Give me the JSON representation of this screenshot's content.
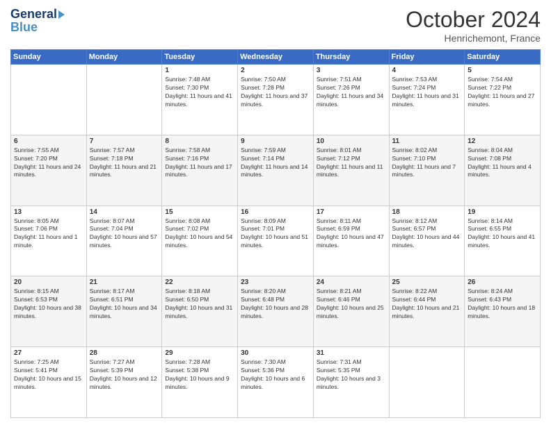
{
  "header": {
    "logo_general": "General",
    "logo_blue": "Blue",
    "month": "October 2024",
    "location": "Henrichemont, France"
  },
  "days_of_week": [
    "Sunday",
    "Monday",
    "Tuesday",
    "Wednesday",
    "Thursday",
    "Friday",
    "Saturday"
  ],
  "weeks": [
    [
      {
        "day": "",
        "sunrise": "",
        "sunset": "",
        "daylight": ""
      },
      {
        "day": "",
        "sunrise": "",
        "sunset": "",
        "daylight": ""
      },
      {
        "day": "1",
        "sunrise": "Sunrise: 7:48 AM",
        "sunset": "Sunset: 7:30 PM",
        "daylight": "Daylight: 11 hours and 41 minutes."
      },
      {
        "day": "2",
        "sunrise": "Sunrise: 7:50 AM",
        "sunset": "Sunset: 7:28 PM",
        "daylight": "Daylight: 11 hours and 37 minutes."
      },
      {
        "day": "3",
        "sunrise": "Sunrise: 7:51 AM",
        "sunset": "Sunset: 7:26 PM",
        "daylight": "Daylight: 11 hours and 34 minutes."
      },
      {
        "day": "4",
        "sunrise": "Sunrise: 7:53 AM",
        "sunset": "Sunset: 7:24 PM",
        "daylight": "Daylight: 11 hours and 31 minutes."
      },
      {
        "day": "5",
        "sunrise": "Sunrise: 7:54 AM",
        "sunset": "Sunset: 7:22 PM",
        "daylight": "Daylight: 11 hours and 27 minutes."
      }
    ],
    [
      {
        "day": "6",
        "sunrise": "Sunrise: 7:55 AM",
        "sunset": "Sunset: 7:20 PM",
        "daylight": "Daylight: 11 hours and 24 minutes."
      },
      {
        "day": "7",
        "sunrise": "Sunrise: 7:57 AM",
        "sunset": "Sunset: 7:18 PM",
        "daylight": "Daylight: 11 hours and 21 minutes."
      },
      {
        "day": "8",
        "sunrise": "Sunrise: 7:58 AM",
        "sunset": "Sunset: 7:16 PM",
        "daylight": "Daylight: 11 hours and 17 minutes."
      },
      {
        "day": "9",
        "sunrise": "Sunrise: 7:59 AM",
        "sunset": "Sunset: 7:14 PM",
        "daylight": "Daylight: 11 hours and 14 minutes."
      },
      {
        "day": "10",
        "sunrise": "Sunrise: 8:01 AM",
        "sunset": "Sunset: 7:12 PM",
        "daylight": "Daylight: 11 hours and 11 minutes."
      },
      {
        "day": "11",
        "sunrise": "Sunrise: 8:02 AM",
        "sunset": "Sunset: 7:10 PM",
        "daylight": "Daylight: 11 hours and 7 minutes."
      },
      {
        "day": "12",
        "sunrise": "Sunrise: 8:04 AM",
        "sunset": "Sunset: 7:08 PM",
        "daylight": "Daylight: 11 hours and 4 minutes."
      }
    ],
    [
      {
        "day": "13",
        "sunrise": "Sunrise: 8:05 AM",
        "sunset": "Sunset: 7:06 PM",
        "daylight": "Daylight: 11 hours and 1 minute."
      },
      {
        "day": "14",
        "sunrise": "Sunrise: 8:07 AM",
        "sunset": "Sunset: 7:04 PM",
        "daylight": "Daylight: 10 hours and 57 minutes."
      },
      {
        "day": "15",
        "sunrise": "Sunrise: 8:08 AM",
        "sunset": "Sunset: 7:02 PM",
        "daylight": "Daylight: 10 hours and 54 minutes."
      },
      {
        "day": "16",
        "sunrise": "Sunrise: 8:09 AM",
        "sunset": "Sunset: 7:01 PM",
        "daylight": "Daylight: 10 hours and 51 minutes."
      },
      {
        "day": "17",
        "sunrise": "Sunrise: 8:11 AM",
        "sunset": "Sunset: 6:59 PM",
        "daylight": "Daylight: 10 hours and 47 minutes."
      },
      {
        "day": "18",
        "sunrise": "Sunrise: 8:12 AM",
        "sunset": "Sunset: 6:57 PM",
        "daylight": "Daylight: 10 hours and 44 minutes."
      },
      {
        "day": "19",
        "sunrise": "Sunrise: 8:14 AM",
        "sunset": "Sunset: 6:55 PM",
        "daylight": "Daylight: 10 hours and 41 minutes."
      }
    ],
    [
      {
        "day": "20",
        "sunrise": "Sunrise: 8:15 AM",
        "sunset": "Sunset: 6:53 PM",
        "daylight": "Daylight: 10 hours and 38 minutes."
      },
      {
        "day": "21",
        "sunrise": "Sunrise: 8:17 AM",
        "sunset": "Sunset: 6:51 PM",
        "daylight": "Daylight: 10 hours and 34 minutes."
      },
      {
        "day": "22",
        "sunrise": "Sunrise: 8:18 AM",
        "sunset": "Sunset: 6:50 PM",
        "daylight": "Daylight: 10 hours and 31 minutes."
      },
      {
        "day": "23",
        "sunrise": "Sunrise: 8:20 AM",
        "sunset": "Sunset: 6:48 PM",
        "daylight": "Daylight: 10 hours and 28 minutes."
      },
      {
        "day": "24",
        "sunrise": "Sunrise: 8:21 AM",
        "sunset": "Sunset: 6:46 PM",
        "daylight": "Daylight: 10 hours and 25 minutes."
      },
      {
        "day": "25",
        "sunrise": "Sunrise: 8:22 AM",
        "sunset": "Sunset: 6:44 PM",
        "daylight": "Daylight: 10 hours and 21 minutes."
      },
      {
        "day": "26",
        "sunrise": "Sunrise: 8:24 AM",
        "sunset": "Sunset: 6:43 PM",
        "daylight": "Daylight: 10 hours and 18 minutes."
      }
    ],
    [
      {
        "day": "27",
        "sunrise": "Sunrise: 7:25 AM",
        "sunset": "Sunset: 5:41 PM",
        "daylight": "Daylight: 10 hours and 15 minutes."
      },
      {
        "day": "28",
        "sunrise": "Sunrise: 7:27 AM",
        "sunset": "Sunset: 5:39 PM",
        "daylight": "Daylight: 10 hours and 12 minutes."
      },
      {
        "day": "29",
        "sunrise": "Sunrise: 7:28 AM",
        "sunset": "Sunset: 5:38 PM",
        "daylight": "Daylight: 10 hours and 9 minutes."
      },
      {
        "day": "30",
        "sunrise": "Sunrise: 7:30 AM",
        "sunset": "Sunset: 5:36 PM",
        "daylight": "Daylight: 10 hours and 6 minutes."
      },
      {
        "day": "31",
        "sunrise": "Sunrise: 7:31 AM",
        "sunset": "Sunset: 5:35 PM",
        "daylight": "Daylight: 10 hours and 3 minutes."
      },
      {
        "day": "",
        "sunrise": "",
        "sunset": "",
        "daylight": ""
      },
      {
        "day": "",
        "sunrise": "",
        "sunset": "",
        "daylight": ""
      }
    ]
  ]
}
